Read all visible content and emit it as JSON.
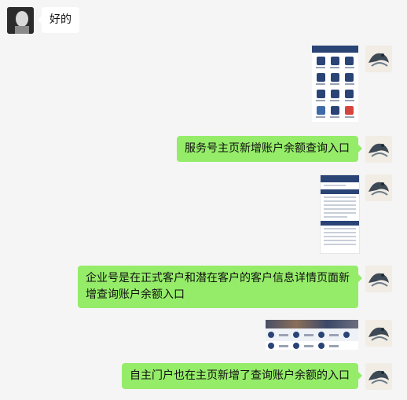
{
  "messages": [
    {
      "side": "left",
      "text": "好的"
    },
    {
      "side": "right",
      "kind": "image",
      "image": "service-account-home-screenshot"
    },
    {
      "side": "right",
      "text": "服务号主页新增账户余额查询入口"
    },
    {
      "side": "right",
      "kind": "image",
      "image": "enterprise-customer-detail-screenshot"
    },
    {
      "side": "right",
      "text": "企业号是在正式客户和潜在客户的客户信息详情页面新增查询账户余额入口"
    },
    {
      "side": "right",
      "kind": "image",
      "image": "self-service-portal-home-screenshot"
    },
    {
      "side": "right",
      "text": "自主门户也在主页新增了查询账户余额的入口"
    }
  ],
  "colors": {
    "background": "#f5f5f5",
    "sent_bubble": "#95ec69",
    "received_bubble": "#ffffff",
    "thumb_header": "#2b4476"
  }
}
